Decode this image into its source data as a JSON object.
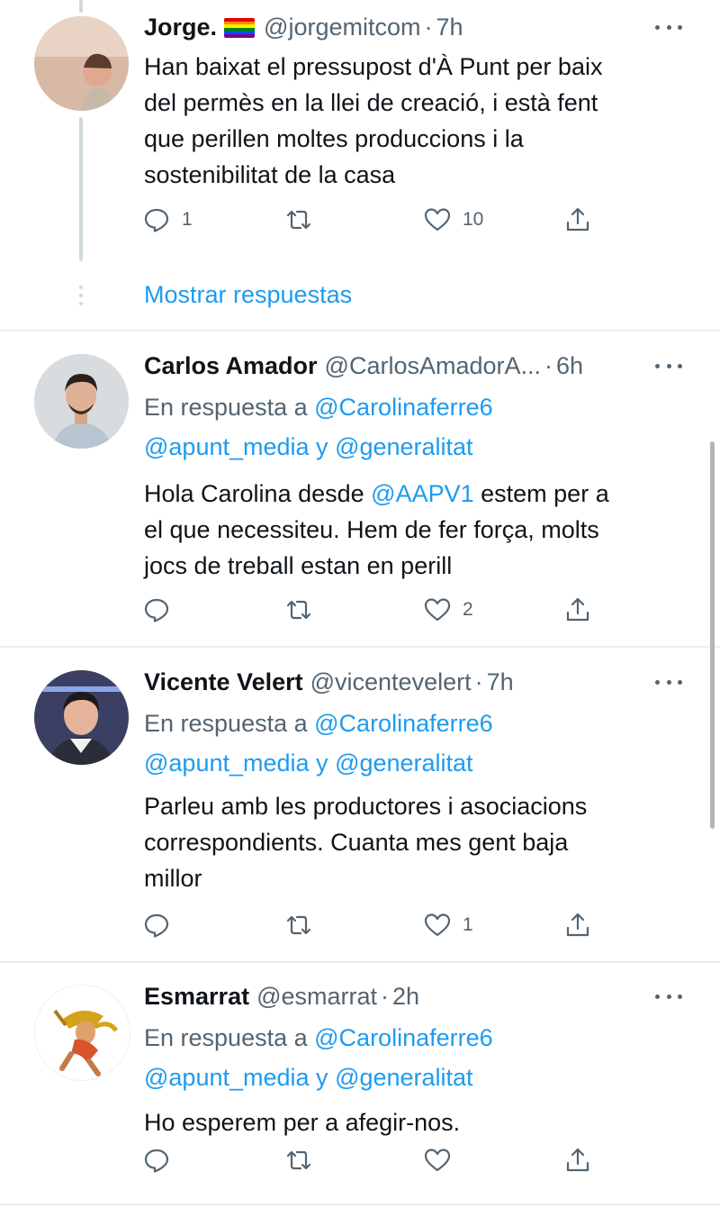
{
  "tweets": [
    {
      "name": "Jorge.",
      "has_flag": true,
      "handle": "@jorgemitcom",
      "sep": "·",
      "time": "7h",
      "lines": [
        "Han baixat el pressupost d'À Punt per baix",
        "del permès en la llei de creació, i està fent",
        "que perillen moltes produccions i la",
        "sostenibilitat de la casa"
      ],
      "reply_count": "1",
      "like_count": "10",
      "show_replies": "Mostrar respuestas"
    },
    {
      "name": "Carlos Amador",
      "handle": "@CarlosAmadorA...",
      "sep": "·",
      "time": "6h",
      "reply_prefix": "En respuesta a",
      "reply_mention1": "@Carolinaferre6",
      "reply_mention2": "@apunt_media",
      "reply_and": "y",
      "reply_mention3": "@generalitat",
      "line1_pre": "Hola Carolina desde",
      "line1_mention": "@AAPV1",
      "line1_post": " estem per a",
      "lines": [
        "el que necessiteu. Hem de fer força, molts",
        "jocs de treball estan en perill"
      ],
      "like_count": "2"
    },
    {
      "name": "Vicente Velert",
      "handle": "@vicentevelert",
      "sep": "·",
      "time": "7h",
      "reply_prefix": "En respuesta a",
      "reply_mention1": "@Carolinaferre6",
      "reply_mention2": "@apunt_media",
      "reply_and": "y",
      "reply_mention3": "@generalitat",
      "lines": [
        "Parleu amb les productores i asociacions",
        "correspondients. Cuanta mes gent baja",
        "millor"
      ],
      "like_count": "1"
    },
    {
      "name": "Esmarrat",
      "handle": "@esmarrat",
      "sep": "·",
      "time": "2h",
      "reply_prefix": "En respuesta a",
      "reply_mention1": "@Carolinaferre6",
      "reply_mention2": "@apunt_media",
      "reply_and": "y",
      "reply_mention3": "@generalitat",
      "lines": [
        "Ho esperem per a afegir-nos."
      ]
    }
  ],
  "colors": {
    "link": "#1d9bf0",
    "secondary": "#536471",
    "text": "#0f1419",
    "divider": "#e9ecee"
  },
  "icons": {
    "reply": "speech-bubble-icon",
    "retweet": "retweet-icon",
    "like": "heart-icon",
    "share": "share-icon",
    "more": "more-horizontal-icon"
  }
}
